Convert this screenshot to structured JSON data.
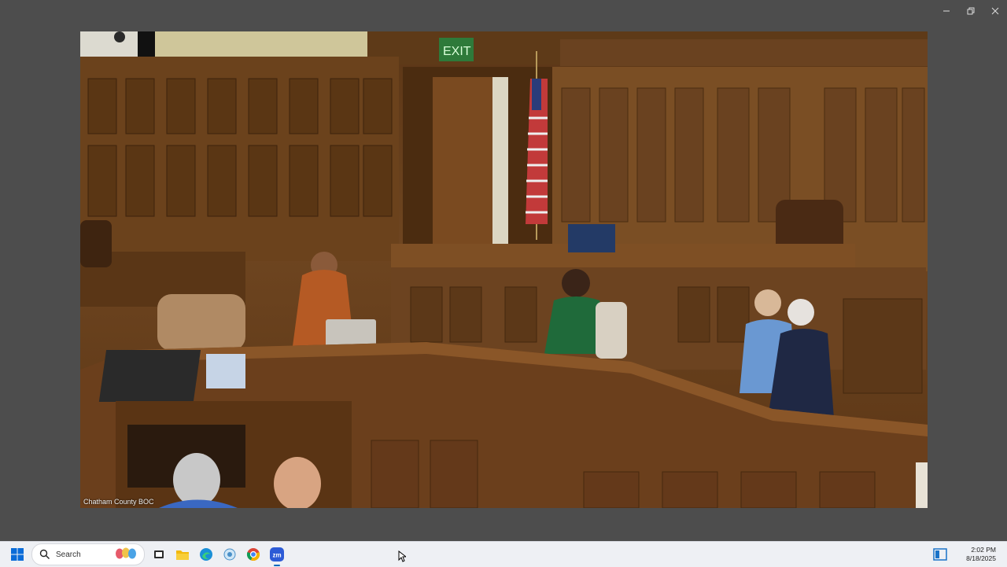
{
  "window": {
    "minimize_icon": "minimize-icon",
    "restore_icon": "restore-icon",
    "close_icon": "close-icon"
  },
  "video": {
    "label": "Chatham County BOC"
  },
  "taskbar": {
    "search_placeholder": "Search",
    "apps": [
      "windows-start",
      "search",
      "task-view",
      "file-explorer",
      "edge",
      "app",
      "chrome",
      "zoom"
    ],
    "time": "2:02 PM",
    "date": "8/18/2025"
  },
  "colors": {
    "taskbar_bg": "#eef0f4",
    "window_bg": "#4d4d4d",
    "accent": "#0067c0",
    "zoom_blue": "#2d5bd6"
  }
}
